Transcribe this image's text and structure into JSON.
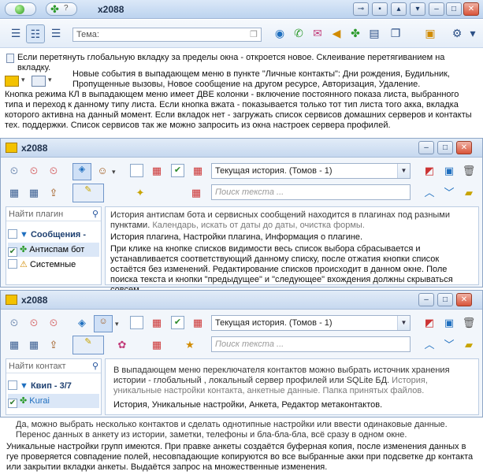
{
  "top_window": {
    "title": "x2088",
    "theme_placeholder": "Тема:"
  },
  "notes": {
    "n1": "Если перетянуть глобальную вкладку за пределы окна - откроется новое. Склеивание перетягиванием на вкладку.",
    "n2": "Новые события в выпадающем меню в пункте \"Личные контакты\": Дни рождения, Будильник, Пропущенные вызовы, Новое сообщение на другом ресурсе, Авторизация, Удаление.",
    "n3": "Кнопка режима КЛ в выпадающем меню имеет ДВЕ колонки - включение постоянного показа листа, выбранного типа и переход к данному типу листа. Если кнопка вжата - показывается только тот тип листа того акка, вкладка которого активна на данный момент. Если вкладок нет - загружать список сервисов домашних серверов и контакты тех. поддержки. Список сервисов так же можно запросить из окна настроек сервера профилей.",
    "n4": "Да, можно выбрать несколько контактов и сделать однотипные настройки или ввести одинаковые данные. Перенос данных в анкету из истории, заметки, телефоны и бла-бла-бла, всё сразу в одном окне.",
    "n5": "Уникальные настройки групп имеются. При правке анкеты создаётся буферная копия, после изменения данных в гуе проверяется совпадение полей, несовпадающие копируются во все выбранные акки при подсветке др контакта или закрытии вкладки анкеты. Выдаётся запрос на множественные изменения."
  },
  "win1": {
    "title": "x2088",
    "history_select": "Текущая история.  (Томов - 1)",
    "search_placeholder": "Поиск текста ...",
    "plugin_search": "Найти плагин",
    "tree": [
      "Сообщения -",
      "Антиспам бот",
      "Системные"
    ],
    "body_gray_lead": "История антиспам бота и сервисных сообщений находится в плагинах под разными пунктами.",
    "body_gray_tail": " Календарь, искать от даты до даты, очистка формы.",
    "body_line2": "История плагина, Настройки плагина, Информация о плагине.",
    "body_para": "При клике на кнопке списков видимости весь список выбора сбрасывается и устанавливается соответствующий данному списку, после отжатия кнопки список остаётся без изменений. Редактирование списков происходит в данном окне. Поле поиска текста и кнопки \"предыдущее\" и \"следующее\" вхождения должны скрываться совсем."
  },
  "win2": {
    "title": "x2088",
    "history_select": "Текущая история.  (Томов - 1)",
    "search_placeholder": "Поиск текста ...",
    "contact_search": "Найти контакт",
    "group": "Квип - 3/7",
    "contact": "Kurai",
    "body_lead": "В выпадающем меню переключателя контактов можно выбрать источник хранения истории - глобальный , локальный сервер профилей или SQLite БД.",
    "body_gray": " История, уникальные настройки контакта, анкетные данные. Папка принятых файлов.",
    "body_line2": "История, Уникальные настройки, Анкета, Редактор метаконтактов."
  },
  "colors": {
    "accent": "#2b4f86",
    "title_text": "#1d2f4a",
    "close_button": "#d9553a"
  }
}
